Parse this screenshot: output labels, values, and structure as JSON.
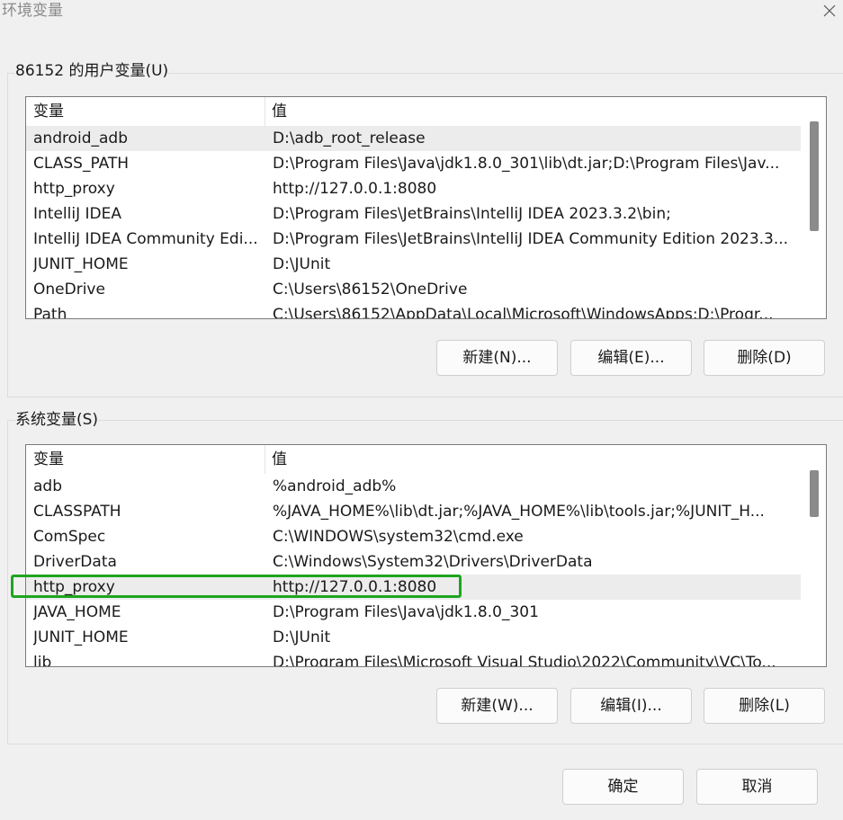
{
  "window": {
    "title": "环境变量",
    "close_icon": "close-icon"
  },
  "user_vars": {
    "group_label": "86152 的用户变量(U)",
    "columns": [
      "变量",
      "值"
    ],
    "rows": [
      {
        "name": "android_adb",
        "value": "D:\\adb_root_release"
      },
      {
        "name": "CLASS_PATH",
        "value": "D:\\Program Files\\Java\\jdk1.8.0_301\\lib\\dt.jar;D:\\Program Files\\Jav..."
      },
      {
        "name": "http_proxy",
        "value": "http://127.0.0.1:8080"
      },
      {
        "name": "IntelliJ IDEA",
        "value": "D:\\Program Files\\JetBrains\\IntelliJ IDEA 2023.3.2\\bin;"
      },
      {
        "name": "IntelliJ IDEA Community Edi...",
        "value": "D:\\Program Files\\JetBrains\\IntelliJ IDEA Community Edition 2023.3..."
      },
      {
        "name": "JUNIT_HOME",
        "value": "D:\\JUnit"
      },
      {
        "name": "OneDrive",
        "value": "C:\\Users\\86152\\OneDrive"
      },
      {
        "name": "Path",
        "value": "C:\\Users\\86152\\AppData\\Local\\Microsoft\\WindowsApps;D:\\Progr..."
      }
    ],
    "buttons": {
      "new": "新建(N)...",
      "edit": "编辑(E)...",
      "delete": "删除(D)"
    }
  },
  "system_vars": {
    "group_label": "系统变量(S)",
    "columns": [
      "变量",
      "值"
    ],
    "rows": [
      {
        "name": "adb",
        "value": "%android_adb%"
      },
      {
        "name": "CLASSPATH",
        "value": "%JAVA_HOME%\\lib\\dt.jar;%JAVA_HOME%\\lib\\tools.jar;%JUNIT_H..."
      },
      {
        "name": "ComSpec",
        "value": "C:\\WINDOWS\\system32\\cmd.exe"
      },
      {
        "name": "DriverData",
        "value": "C:\\Windows\\System32\\Drivers\\DriverData"
      },
      {
        "name": "http_proxy",
        "value": "http://127.0.0.1:8080"
      },
      {
        "name": "JAVA_HOME",
        "value": "D:\\Program Files\\Java\\jdk1.8.0_301"
      },
      {
        "name": "JUNIT_HOME",
        "value": "D:\\JUnit"
      },
      {
        "name": "lib",
        "value": "D:\\Program Files\\Microsoft Visual Studio\\2022\\Community\\VC\\To..."
      }
    ],
    "buttons": {
      "new": "新建(W)...",
      "edit": "编辑(I)...",
      "delete": "删除(L)"
    }
  },
  "footer": {
    "ok": "确定",
    "cancel": "取消"
  },
  "colors": {
    "highlight_border": "#1fa51f",
    "row_hover": "#ececec"
  }
}
